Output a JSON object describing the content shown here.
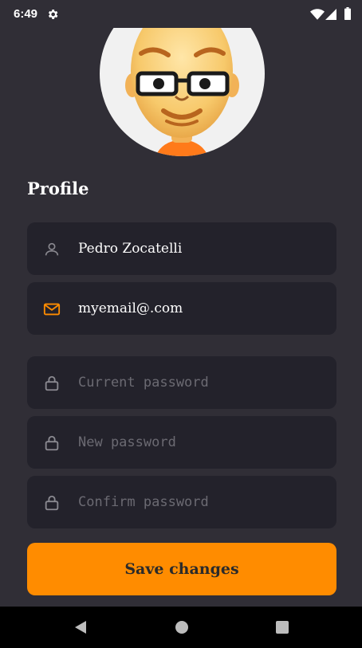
{
  "status_bar": {
    "time": "6:49",
    "icons": [
      "gear-icon",
      "wifi-icon",
      "signal-icon",
      "battery-icon"
    ]
  },
  "profile": {
    "section_title": "Profile",
    "name": "Pedro Zocatelli",
    "email": "myemail@.com"
  },
  "password": {
    "current_placeholder": "Current password",
    "new_placeholder": "New password",
    "confirm_placeholder": "Confirm password"
  },
  "actions": {
    "save_label": "Save changes"
  },
  "nav_bar": {
    "icons": [
      "back-icon",
      "home-icon",
      "recents-icon"
    ]
  },
  "colors": {
    "background": "#302e36",
    "field_background": "#23222b",
    "accent": "#ff8c00",
    "text": "#ffffff",
    "placeholder": "#6b6a72"
  }
}
